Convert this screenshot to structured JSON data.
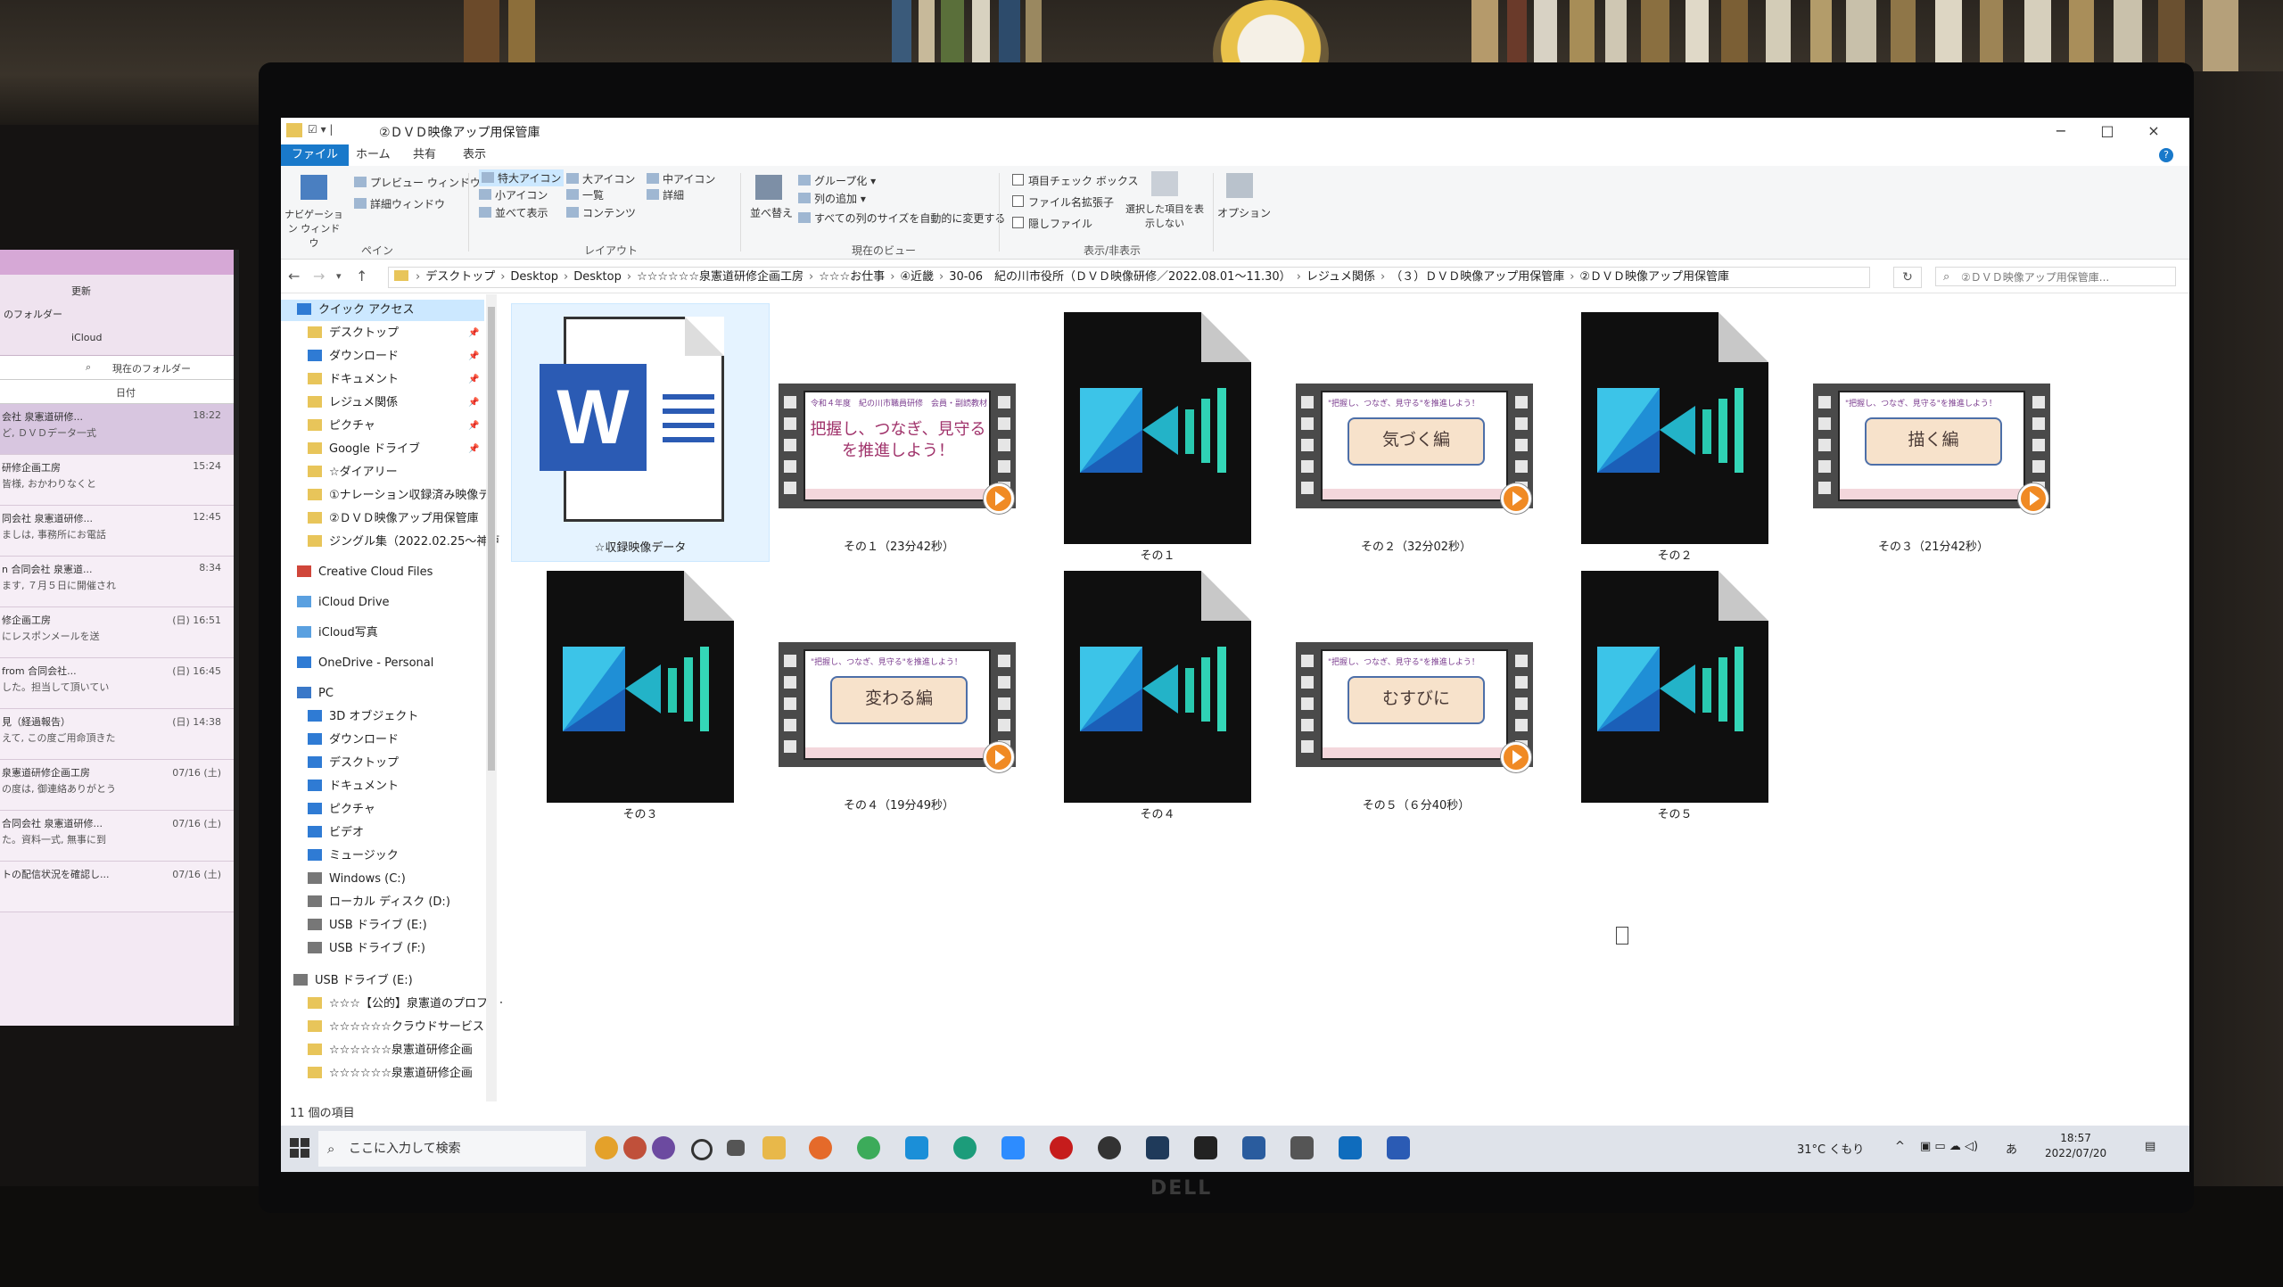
{
  "window": {
    "title": "②ＤＶＤ映像アップ用保管庫",
    "controls": {
      "minimize": "−",
      "maximize": "□",
      "close": "×"
    },
    "help": "?"
  },
  "tabs": [
    {
      "label": "ファイル",
      "active": true
    },
    {
      "label": "ホーム"
    },
    {
      "label": "共有"
    },
    {
      "label": "表示"
    }
  ],
  "ribbon": {
    "pane": {
      "nav_pane": "ナビゲーション ウィンドウ",
      "preview": "プレビュー ウィンドウ",
      "details": "詳細ウィンドウ",
      "group": "ペイン"
    },
    "layout": {
      "xl_icons": "特大アイコン",
      "large_icons": "大アイコン",
      "medium_icons": "中アイコン",
      "small_icons": "小アイコン",
      "list": "一覧",
      "details": "詳細",
      "tiles": "並べて表示",
      "content": "コンテンツ",
      "group": "レイアウト"
    },
    "current_view": {
      "sort": "並べ替え",
      "group_by": "グループ化",
      "add_columns": "列の追加",
      "fit_columns": "すべての列のサイズを自動的に変更する",
      "group": "現在のビュー"
    },
    "show_hide": {
      "item_checkboxes": "項目チェック ボックス",
      "file_extensions": "ファイル名拡張子",
      "hidden_items": "隠しファイル",
      "hide_selected": "選択した項目を表示しない",
      "group": "表示/非表示"
    },
    "options": "オプション"
  },
  "address": {
    "crumbs": [
      "デスクトップ",
      "Desktop",
      "Desktop",
      "☆☆☆☆☆☆泉憲道研修企画工房",
      "☆☆☆お仕事",
      "④近畿",
      "30-06　紀の川市役所（ＤＶＤ映像研修／2022.08.01～11.30）",
      "レジュメ関係",
      "（３）ＤＶＤ映像アップ用保管庫",
      "②ＤＶＤ映像アップ用保管庫"
    ],
    "search_placeholder": "②ＤＶＤ映像アップ用保管庫..."
  },
  "nav": {
    "quick_access": "クイック アクセス",
    "quick": [
      "デスクトップ",
      "ダウンロード",
      "ドキュメント",
      "レジュメ関係",
      "ピクチャ",
      "Google ドライブ",
      "☆ダイアリー",
      "①ナレーション収録済み映像デ",
      "②ＤＶＤ映像アップ用保管庫",
      "ジングル集（2022.02.25～神戸"
    ],
    "creative_cloud": "Creative Cloud Files",
    "icloud_drive": "iCloud Drive",
    "icloud_photos": "iCloud写真",
    "onedrive": "OneDrive - Personal",
    "pc": "PC",
    "pc_items": [
      "3D オブジェクト",
      "ダウンロード",
      "デスクトップ",
      "ドキュメント",
      "ピクチャ",
      "ビデオ",
      "ミュージック",
      "Windows (C:)",
      "ローカル ディスク (D:)",
      "USB ドライブ (E:)",
      "USB ドライブ (F:)"
    ],
    "usb": "USB ドライブ (E:)",
    "usb_items": [
      "☆☆☆【公的】泉憲道のプロフィー",
      "☆☆☆☆☆☆クラウドサービス（",
      "☆☆☆☆☆☆泉憲道研修企画",
      "☆☆☆☆☆☆泉憲道研修企画"
    ]
  },
  "files": [
    {
      "name": "☆収録映像データ",
      "kind": "word"
    },
    {
      "name": "その１（23分42秒）",
      "kind": "film",
      "top": "令和４年度　紀の川市職員研修　会員・副読教材",
      "text1": "把握し、つなぎ、見守る",
      "text2": "を推進しよう！"
    },
    {
      "name": "その１",
      "kind": "pd"
    },
    {
      "name": "その２（32分02秒）",
      "kind": "film",
      "top": "\"把握し、つなぎ、見守る\"を推進しよう！",
      "box": "気づく編"
    },
    {
      "name": "その２",
      "kind": "pd"
    },
    {
      "name": "その３（21分42秒）",
      "kind": "film",
      "top": "\"把握し、つなぎ、見守る\"を推進しよう！",
      "box": "描く編"
    },
    {
      "name": "その３",
      "kind": "pd"
    },
    {
      "name": "その４（19分49秒）",
      "kind": "film",
      "top": "\"把握し、つなぎ、見守る\"を推進しよう！",
      "box": "変わる編"
    },
    {
      "name": "その４",
      "kind": "pd"
    },
    {
      "name": "その５（６分40秒）",
      "kind": "film",
      "top": "\"把握し、つなぎ、見守る\"を推進しよう！",
      "box": "むすびに"
    },
    {
      "name": "その５",
      "kind": "pd"
    }
  ],
  "status": "11 個の項目",
  "taskbar": {
    "search_placeholder": "ここに入力して検索",
    "weather": "31°C くもり",
    "ime": "あ",
    "time": "18:57",
    "date": "2022/07/20"
  },
  "laptop": {
    "folder_label": "のフォルダー",
    "update": "更新",
    "icloud": "iCloud",
    "filter": "現在のフォルダー",
    "sort": "日付",
    "mails": [
      {
        "from": "会社 泉憲道研修...",
        "preview": "ど, ＤＶＤデータ一式",
        "date": "18:22"
      },
      {
        "from": "研修企画工房",
        "preview": "皆様, おかわりなくと",
        "date": "15:24"
      },
      {
        "from": "同会社 泉憲道研修...",
        "preview": "ましは, 事務所にお電話",
        "date": "12:45"
      },
      {
        "from": "n 合同会社 泉憲道...",
        "preview": "ます, ７月５日に開催され",
        "date": "8:34"
      },
      {
        "from": "修企画工房",
        "preview": "にレスポンメールを送",
        "date": "(日) 16:51"
      },
      {
        "from": "from 合同会社...",
        "preview": "した。担当して頂いてい",
        "date": "(日) 16:45"
      },
      {
        "from": "見（経過報告）",
        "preview": "えて, この度ご用命頂きた",
        "date": "(日) 14:38"
      },
      {
        "from": "泉憲道研修企画工房",
        "preview": "の度は, 御連絡ありがとう",
        "date": "07/16 (土)"
      },
      {
        "from": "合同会社 泉憲道研修...",
        "preview": "た。資料一式, 無事に到",
        "date": "07/16 (土)"
      },
      {
        "from": "トの配信状況を確認し...",
        "preview": "",
        "date": "07/16 (土)"
      }
    ]
  }
}
